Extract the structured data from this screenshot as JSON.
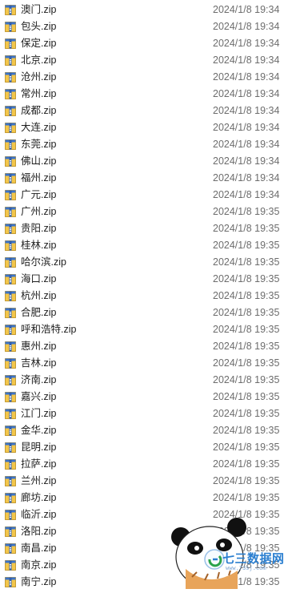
{
  "files": [
    {
      "name": "澳门.zip",
      "modified": "2024/1/8 19:34"
    },
    {
      "name": "包头.zip",
      "modified": "2024/1/8 19:34"
    },
    {
      "name": "保定.zip",
      "modified": "2024/1/8 19:34"
    },
    {
      "name": "北京.zip",
      "modified": "2024/1/8 19:34"
    },
    {
      "name": "沧州.zip",
      "modified": "2024/1/8 19:34"
    },
    {
      "name": "常州.zip",
      "modified": "2024/1/8 19:34"
    },
    {
      "name": "成都.zip",
      "modified": "2024/1/8 19:34"
    },
    {
      "name": "大连.zip",
      "modified": "2024/1/8 19:34"
    },
    {
      "name": "东莞.zip",
      "modified": "2024/1/8 19:34"
    },
    {
      "name": "佛山.zip",
      "modified": "2024/1/8 19:34"
    },
    {
      "name": "福州.zip",
      "modified": "2024/1/8 19:34"
    },
    {
      "name": "广元.zip",
      "modified": "2024/1/8 19:34"
    },
    {
      "name": "广州.zip",
      "modified": "2024/1/8 19:35"
    },
    {
      "name": "贵阳.zip",
      "modified": "2024/1/8 19:35"
    },
    {
      "name": "桂林.zip",
      "modified": "2024/1/8 19:35"
    },
    {
      "name": "哈尔滨.zip",
      "modified": "2024/1/8 19:35"
    },
    {
      "name": "海口.zip",
      "modified": "2024/1/8 19:35"
    },
    {
      "name": "杭州.zip",
      "modified": "2024/1/8 19:35"
    },
    {
      "name": "合肥.zip",
      "modified": "2024/1/8 19:35"
    },
    {
      "name": "呼和浩特.zip",
      "modified": "2024/1/8 19:35"
    },
    {
      "name": "惠州.zip",
      "modified": "2024/1/8 19:35"
    },
    {
      "name": "吉林.zip",
      "modified": "2024/1/8 19:35"
    },
    {
      "name": "济南.zip",
      "modified": "2024/1/8 19:35"
    },
    {
      "name": "嘉兴.zip",
      "modified": "2024/1/8 19:35"
    },
    {
      "name": "江门.zip",
      "modified": "2024/1/8 19:35"
    },
    {
      "name": "金华.zip",
      "modified": "2024/1/8 19:35"
    },
    {
      "name": "昆明.zip",
      "modified": "2024/1/8 19:35"
    },
    {
      "name": "拉萨.zip",
      "modified": "2024/1/8 19:35"
    },
    {
      "name": "兰州.zip",
      "modified": "2024/1/8 19:35"
    },
    {
      "name": "廊坊.zip",
      "modified": "2024/1/8 19:35"
    },
    {
      "name": "临沂.zip",
      "modified": "2024/1/8 19:35"
    },
    {
      "name": "洛阳.zip",
      "modified": "2024/1/8 19:35"
    },
    {
      "name": "南昌.zip",
      "modified": "2024/1/8 19:35"
    },
    {
      "name": "南京.zip",
      "modified": "2024/1/8 19:35"
    },
    {
      "name": "南宁.zip",
      "modified": "2024/1/8 19:35"
    }
  ],
  "file_icon": "zip-archive-icon",
  "watermark": {
    "text": "七三数据网",
    "url": "www.73sj.com"
  },
  "colors": {
    "date_text": "#6d6d6d",
    "name_text": "#1e1e1e",
    "watermark_blue": "#2b7fd0"
  }
}
